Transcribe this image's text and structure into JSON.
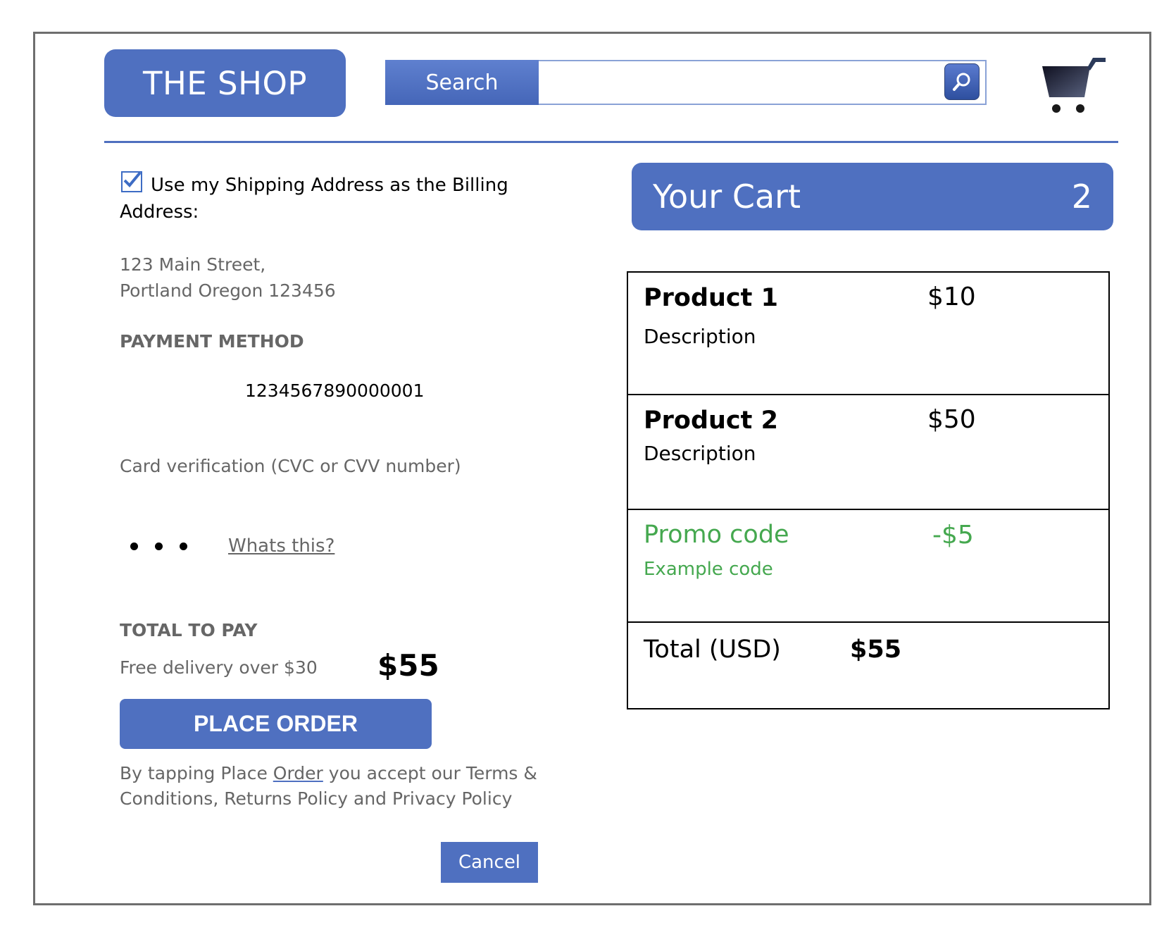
{
  "header": {
    "logo": "THE SHOP",
    "search_label": "Search",
    "search_placeholder": "",
    "search_icon": "magnifier-icon",
    "cart_icon": "shopping-cart-icon"
  },
  "billing": {
    "checkbox_checked": true,
    "checkbox_label": "Use my Shipping Address as the Billing Address:",
    "address_line1": "123 Main Street,",
    "address_line2": "Portland Oregon 123456"
  },
  "payment": {
    "section_title": "PAYMENT METHOD",
    "card_number": "1234567890000001",
    "cvc_label": "Card verification (CVC or CVV number)",
    "cvc_masked": "• • •",
    "whats_this": "Whats this?"
  },
  "total": {
    "title": "TOTAL TO PAY",
    "free_delivery": "Free delivery over $30",
    "amount": "$55",
    "place_order": "PLACE ORDER",
    "legal_before": "By tapping Place ",
    "legal_underlined": "Order",
    "legal_after": " you accept our Terms & Conditions, Returns Policy and Privacy Policy",
    "cancel": "Cancel"
  },
  "cart": {
    "title": "Your Cart",
    "count": "2",
    "items": [
      {
        "name": "Product 1",
        "description": "Description",
        "price": "$10"
      },
      {
        "name": "Product 2",
        "description": "Description",
        "price": "$50"
      }
    ],
    "promo": {
      "name": "Promo code",
      "description": "Example code",
      "price": "-$5"
    },
    "total_label": "Total (USD)",
    "total_value": "$55"
  },
  "colors": {
    "primary": "#4f70c0",
    "promo_green": "#45a84f",
    "muted_text": "#666666"
  }
}
